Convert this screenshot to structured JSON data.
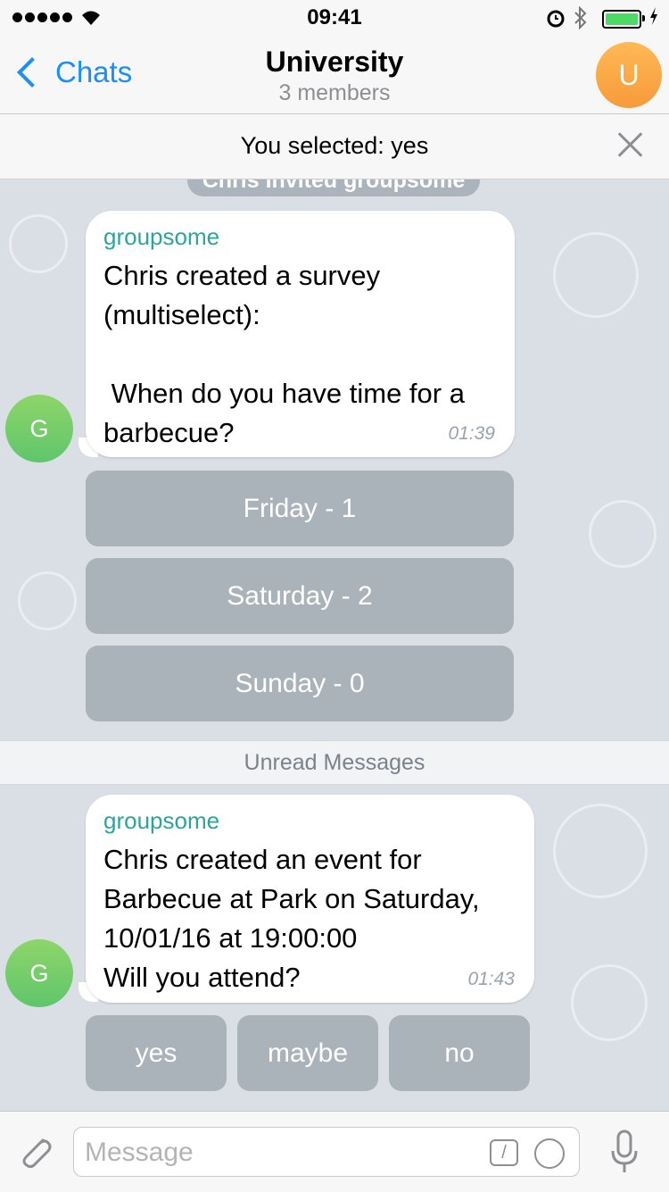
{
  "status_bar": {
    "time": "09:41",
    "wifi_icon": "wifi-icon",
    "alarm_icon": "alarm-icon",
    "bluetooth_icon": "bluetooth-icon",
    "battery_icon": "battery-icon"
  },
  "header": {
    "back_label": "Chats",
    "title": "University",
    "subtitle": "3 members",
    "avatar_letter": "U"
  },
  "selection_banner": {
    "text": "You selected: yes"
  },
  "service_message": "Chris invited groupsome",
  "messages": [
    {
      "sender": "groupsome",
      "avatar_letter": "G",
      "text": "Chris created a survey (multiselect):\n\n When do you have time for a barbecue?",
      "time": "01:39",
      "buttons": [
        "Friday - 1",
        "Saturday - 2",
        "Sunday - 0"
      ]
    },
    {
      "sender": "groupsome",
      "avatar_letter": "G",
      "text": "Chris created an event for Barbecue at Park on Saturday, 10/01/16 at 19:00:00\nWill you attend?",
      "time": "01:43",
      "buttons": [
        "yes",
        "maybe",
        "no"
      ]
    }
  ],
  "unread_label": "Unread Messages",
  "input_bar": {
    "placeholder": "Message",
    "command_icon_glyph": "/"
  },
  "colors": {
    "accent": "#1d8ef7",
    "sender": "#2ca59b",
    "avatar_user": "#f7a23e",
    "avatar_group": "#6ccb6b"
  }
}
